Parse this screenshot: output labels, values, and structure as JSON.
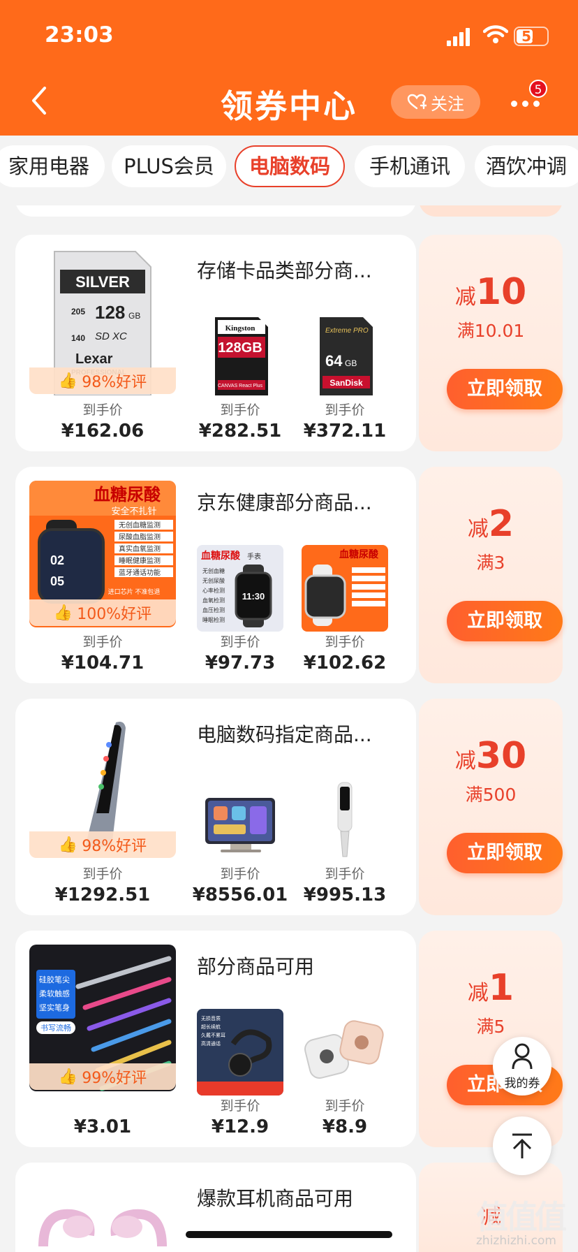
{
  "status": {
    "time": "23:03",
    "battery": "55"
  },
  "nav": {
    "title": "领券中心",
    "follow_label": "关注",
    "badge_count": "5"
  },
  "categories": [
    "家用电器",
    "PLUS会员",
    "电脑数码",
    "手机通讯",
    "酒饮冲调"
  ],
  "active_category": "电脑数码",
  "price_label": "到手价",
  "claim_label": "立即领取",
  "coupons": [
    {
      "title": "存储卡品类部分商...",
      "rating": "98%好评",
      "prices": [
        "¥162.06",
        "¥282.51",
        "¥372.11"
      ],
      "discount_prefix": "减",
      "discount": "10",
      "min_spend": "满10.01",
      "images": [
        "lexar-silver-sd-card",
        "kingston-canvas-react-plus-sd-card",
        "sandisk-extreme-pro-sd-card"
      ]
    },
    {
      "title": "京东健康部分商品...",
      "rating": "100%好评",
      "prices": [
        "¥104.71",
        "¥97.73",
        "¥102.62"
      ],
      "discount_prefix": "减",
      "discount": "2",
      "min_spend": "满3",
      "images": [
        "blood-sugar-smartwatch",
        "smartwatch-features",
        "orange-band-smartwatch"
      ],
      "watch_text": {
        "headline": "血糖尿酸",
        "sub": "安全不扎针",
        "features": [
          "无创血糖监测",
          "尿酸血脂监测",
          "真实血氧监测",
          "睡眠健康监测",
          "蓝牙通话功能"
        ],
        "foot": "进口芯片 不准包退",
        "headline2": "血糖尿酸",
        "tag2": "手表",
        "features2": [
          "无创血糖",
          "无创尿酸",
          "心率检测",
          "血氧检测",
          "血压检测",
          "睡眠检测"
        ],
        "watch_time": "11:30"
      }
    },
    {
      "title": "电脑数码指定商品...",
      "rating": "98%好评",
      "prices": [
        "¥1292.51",
        "¥8556.01",
        "¥995.13"
      ],
      "discount_prefix": "减",
      "discount": "30",
      "min_spend": "满500",
      "images": [
        "translation-pen",
        "tablet-on-stand",
        "white-translation-pen"
      ]
    },
    {
      "title": "部分商品可用",
      "rating": "99%好评",
      "prices": [
        "¥3.01",
        "¥12.9",
        "¥8.9"
      ],
      "show_price_label_first": false,
      "discount_prefix": "减",
      "discount": "1",
      "min_spend": "满5",
      "images": [
        "stylus-pens",
        "open-ear-earphones",
        "earphones-in-case"
      ],
      "stylus_text": [
        "硅胶笔尖",
        "柔软触感",
        "坚实笔身"
      ],
      "stylus_tag": "书写流畅",
      "ear_text": [
        "无损音质",
        "超长续航",
        "久戴不累耳",
        "高清通话"
      ]
    },
    {
      "title": "爆款耳机商品可用",
      "discount_prefix": "减",
      "images": [
        "pink-open-ear-earphones"
      ]
    }
  ],
  "floating": {
    "my_coupon_label": "我的券"
  },
  "watermark": {
    "big": "值值值",
    "small": "zhizhizhi.com"
  },
  "colors": {
    "header": "#ff6a1a",
    "accent": "#e8402a",
    "button": "#ff6a1a"
  }
}
